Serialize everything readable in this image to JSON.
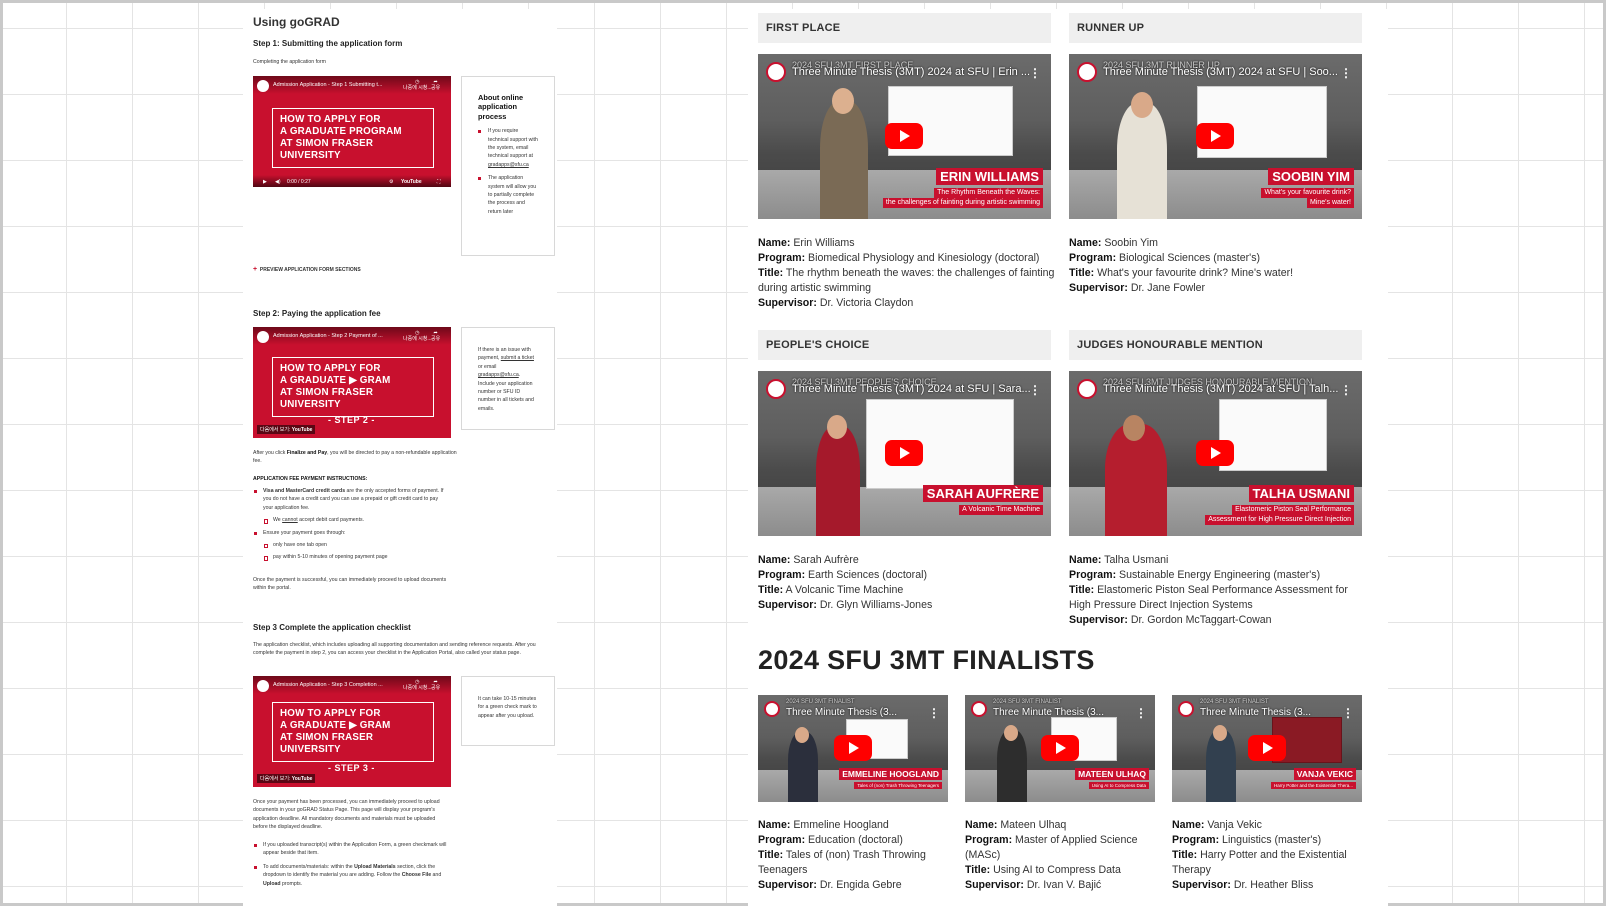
{
  "left": {
    "heading": "Using goGRAD",
    "step1": {
      "title": "Step 1: Submitting the application form",
      "intro": "Completing the application form",
      "video": {
        "title": "Admission Application - Step 1 Submitting t...",
        "watch_later": "나중에 시청...",
        "share": "공유",
        "line1": "HOW TO APPLY FOR",
        "line2": "A GRADUATE PROGRAM",
        "line3": "AT SIMON FRASER UNIVERSITY",
        "time": "0:00 / 0:27",
        "platform": "YouTube"
      },
      "aside_title": "About online application process",
      "aside_items": [
        {
          "text": "If you require technical support with the system, email technical support at ",
          "link": "gradapps@sfu.ca"
        },
        {
          "text": "The application system will allow you to partially complete the process and return later",
          "link": ""
        }
      ],
      "preview_link": "PREVIEW APPLICATION FORM SECTIONS"
    },
    "step2": {
      "title": "Step 2: Paying the application fee",
      "video": {
        "title": "Admission Application - Step 2 Payment of ...",
        "watch_later": "나중에 시청...",
        "share": "공유",
        "line1": "HOW TO APPLY FOR",
        "line2": "A GRADUATE ▶ GRAM",
        "line3": "AT SIMON FRASER UNIVERSITY",
        "step": "- STEP 2 -",
        "watch_on": "다음에서 보기:",
        "platform": "YouTube"
      },
      "aside_pre": "If there is an issue with payment, ",
      "aside_link1": "submit a ticket",
      "aside_mid": " or email ",
      "aside_link2": "gradapps@sfu.ca",
      "aside_post": ". Include your application number or SFU ID number in all tickets and emails.",
      "after_pre": "After you click ",
      "after_bold": "Finalize and Pay",
      "after_post": ", you will be directed to pay a non-refundable application fee.",
      "instructions_title": "APPLICATION FEE PAYMENT INSTRUCTIONS:",
      "b1_bold": "Visa and MasterCard credit cards",
      "b1_text": " are the only accepted forms of payment. If you do not have a credit card you can use a prepaid or gift credit card to pay your application fee.",
      "b1_sub_pre": "We ",
      "b1_sub_u": "cannot",
      "b1_sub_post": " accept debit card payments.",
      "b2_text": "Ensure your payment goes through:",
      "b2_sub1": "only have one tab open",
      "b2_sub2": "pay within 5-10 minutes of opening payment page",
      "success": "Once the payment is successful, you can immediately proceed to upload documents within the portal."
    },
    "step3": {
      "title": "Step 3 Complete the application checklist",
      "intro": "The application checklist, which includes uploading all supporting documentation and sending reference requests. After you complete the payment in step 2, you can access your checklist in the Application Portal, also called your status page.",
      "video": {
        "title": "Admission Application - Step 3 Completion ...",
        "watch_later": "나중에 시청...",
        "share": "공유",
        "line1": "HOW TO APPLY FOR",
        "line2": "A GRADUATE ▶ GRAM",
        "line3": "AT SIMON FRASER UNIVERSITY",
        "step": "- STEP 3 -",
        "watch_on": "다음에서 보기:",
        "platform": "YouTube"
      },
      "aside": "It can take 10-15 minutes for a green check mark to appear after you upload.",
      "para": "Once your payment has been processed, you can immediately proceed to upload documents in your goGRAD Status Page. This page will display your program's application deadline. All mandatory documents and materials must be uploaded before the displayed deadline.",
      "b1": "If you uploaded transcript(s) within the Application Form, a green checkmark will appear beside that item.",
      "b2_pre": "To add documents/materials: within the ",
      "b2_bold1": "Upload Materials",
      "b2_mid": " section, click the dropdown to identify the material you are adding. Follow the ",
      "b2_bold2": "Choose File",
      "b2_and": " and ",
      "b2_bold3": "Upload",
      "b2_post": " prompts."
    }
  },
  "labels": {
    "name": "Name:",
    "program": "Program:",
    "title": "Title:",
    "supervisor": "Supervisor:"
  },
  "winners": [
    {
      "category": "FIRST PLACE",
      "video_title": "Three Minute Thesis (3MT) 2024 at SFU | Erin ...",
      "overlay": "2024 SFU 3MT FIRST PLACE",
      "thumb_name": "ERIN WILLIAMS",
      "thumb_sub1": "The Rhythm Beneath the Waves:",
      "thumb_sub2": "the challenges of fainting during artistic swimming",
      "name": "Erin Williams",
      "program": "Biomedical Physiology and Kinesiology (doctoral)",
      "title": "The rhythm beneath the waves: the challenges of fainting during artistic swimming",
      "supervisor": "Dr. Victoria Claydon"
    },
    {
      "category": "RUNNER UP",
      "video_title": "Three Minute Thesis (3MT) 2024 at SFU | Soo...",
      "overlay": "2024 SFU 3MT RUNNER UP",
      "thumb_name": "SOOBIN YIM",
      "thumb_sub1": "What's your favourite drink?",
      "thumb_sub2": "Mine's water!",
      "name": "Soobin Yim",
      "program": "Biological Sciences (master's)",
      "title": "What's your favourite drink? Mine's water!",
      "supervisor": "Dr. Jane Fowler"
    },
    {
      "category": "PEOPLE'S CHOICE",
      "video_title": "Three Minute Thesis (3MT) 2024 at SFU | Sara...",
      "overlay": "2024 SFU 3MT PEOPLE'S CHOICE",
      "thumb_name": "SARAH AUFRÈRE",
      "thumb_sub1": "A Volcanic Time Machine",
      "thumb_sub2": "",
      "name": "Sarah Aufrère",
      "program": "Earth Sciences (doctoral)",
      "title": "A Volcanic Time Machine",
      "supervisor": "Dr. Glyn Williams-Jones"
    },
    {
      "category": "JUDGES HONOURABLE MENTION",
      "video_title": "Three Minute Thesis (3MT) 2024 at SFU | Talh...",
      "overlay": "2024 SFU 3MT JUDGES HONOURABLE MENTION",
      "thumb_name": "TALHA USMANI",
      "thumb_sub1": "Elastomeric Piston Seal Performance",
      "thumb_sub2": "Assessment for High Pressure Direct Injection",
      "name": "Talha Usmani",
      "program": "Sustainable Energy Engineering (master's)",
      "title": "Elastomeric Piston Seal Performance Assessment for High Pressure Direct Injection Systems",
      "supervisor": "Dr. Gordon McTaggart-Cowan"
    }
  ],
  "finalists_heading": "2024 SFU 3MT FINALISTS",
  "finalists": [
    {
      "video_title": "Three Minute Thesis (3...",
      "overlay": "2024 SFU 3MT FINALIST",
      "thumb_name": "EMMELINE HOOGLAND",
      "thumb_sub1": "Tales of (non) Trash Throwing Teenagers",
      "name": "Emmeline Hoogland",
      "program": "Education (doctoral)",
      "title": "Tales of (non) Trash Throwing Teenagers",
      "supervisor": "Dr. Engida Gebre"
    },
    {
      "video_title": "Three Minute Thesis (3...",
      "overlay": "2024 SFU 3MT FINALIST",
      "thumb_name": "MATEEN ULHAQ",
      "thumb_sub1": "Using AI to Compress Data",
      "name": "Mateen Ulhaq",
      "program": "Master of Applied Science (MASc)",
      "title": "Using AI to Compress Data",
      "supervisor": "Dr. Ivan V. Bajić"
    },
    {
      "video_title": "Three Minute Thesis (3...",
      "overlay": "2024 SFU 3MT FINALIST",
      "thumb_name": "VANJA VEKIC",
      "thumb_sub1": "Harry Potter and the Existential Thera...",
      "name": "Vanja Vekic",
      "program": "Linguistics (master's)",
      "title": "Harry Potter and the Existential Therapy",
      "supervisor": "Dr. Heather Bliss"
    }
  ]
}
